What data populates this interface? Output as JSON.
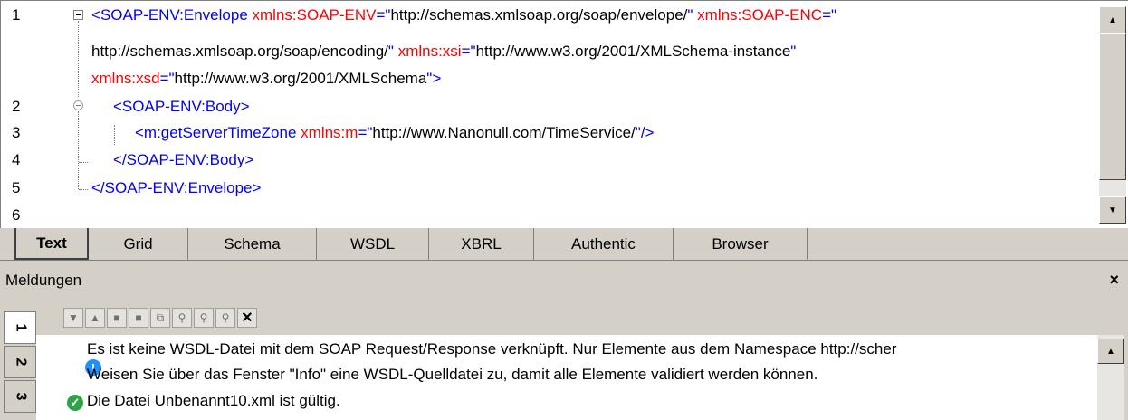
{
  "editor": {
    "line_numbers": [
      "1",
      "2",
      "3",
      "4",
      "5",
      "6"
    ],
    "line1a": {
      "bracket": "<",
      "tag": "SOAP-ENV:Envelope",
      "attr1": "xmlns:SOAP-ENV",
      "eq1": "=\"",
      "val1": "http://schemas.xmlsoap.org/soap/envelope/",
      "q1": "\"",
      "attr2": "xmlns:SOAP-ENC",
      "eq2": "=\""
    },
    "line1b": {
      "val": "http://schemas.xmlsoap.org/soap/encoding/",
      "q": "\"",
      "attr": "xmlns:xsi",
      "eq": "=\"",
      "val2": "http://www.w3.org/2001/XMLSchema-instance",
      "q2": "\""
    },
    "line1c": {
      "attr": "xmlns:xsd",
      "eq": "=\"",
      "val": "http://www.w3.org/2001/XMLSchema",
      "close": "\">"
    },
    "line2": "<SOAP-ENV:Body>",
    "line3": {
      "tag": "<m:getServerTimeZone",
      "attr": "xmlns:m",
      "eq": "=\"",
      "val": "http://www.Nanonull.com/TimeService/",
      "close": "\"/>"
    },
    "line4": "</SOAP-ENV:Body>",
    "line5": "</SOAP-ENV:Envelope>"
  },
  "view_tabs": [
    "Text",
    "Grid",
    "Schema",
    "WSDL",
    "XBRL",
    "Authentic",
    "Browser"
  ],
  "active_view_tab": "Text",
  "messages": {
    "title": "Meldungen",
    "close_label": "×",
    "side_tabs": [
      "1",
      "2",
      "3"
    ],
    "toolbar_icons": [
      "next-icon",
      "previous-icon",
      "copy-icon",
      "copy-all-icon",
      "copy-message-icon",
      "find-icon",
      "find-next-icon",
      "find-previous-icon",
      "clear-icon"
    ],
    "items": [
      {
        "type": "info",
        "text": "Es ist keine WSDL-Datei mit dem SOAP Request/Response verknüpft. Nur Elemente aus dem Namespace http://scher"
      },
      {
        "type": "text",
        "text": "Weisen Sie über das Fenster \"Info\" eine WSDL-Quelldatei zu, damit alle Elemente validiert werden können."
      },
      {
        "type": "ok",
        "text": "Die Datei Unbenannt10.xml ist gültig."
      }
    ],
    "colors": {
      "info": "#1e90ff",
      "ok": "#2ea34a"
    }
  }
}
